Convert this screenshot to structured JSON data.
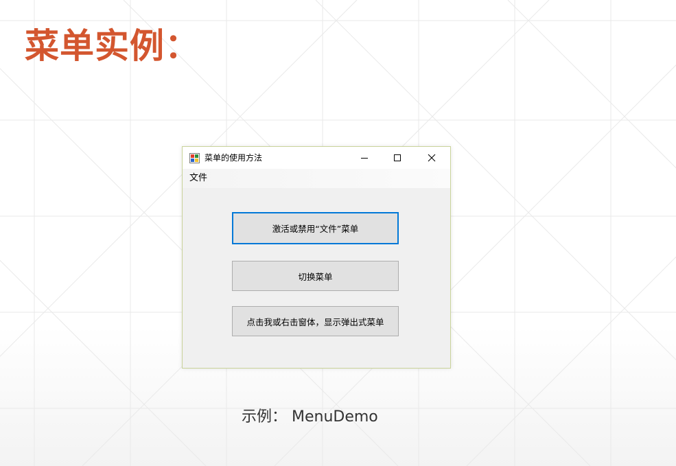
{
  "slide": {
    "title": "菜单实例：",
    "caption": "示例： MenuDemo"
  },
  "window": {
    "title": "菜单的使用方法",
    "icon": "windows-form-icon",
    "controls": {
      "minimize": "minimize-icon",
      "maximize": "maximize-icon",
      "close": "close-icon"
    }
  },
  "menubar": {
    "items": [
      {
        "label": "文件"
      }
    ]
  },
  "buttons": [
    {
      "label": "激活或禁用“文件”菜单"
    },
    {
      "label": "切换菜单"
    },
    {
      "label": "点击我或右击窗体，显示弹出式菜单"
    }
  ],
  "colors": {
    "title": "#d3562f",
    "focus_border": "#0078d7",
    "button_bg": "#e1e1e1",
    "window_bg": "#f0f0f0"
  }
}
